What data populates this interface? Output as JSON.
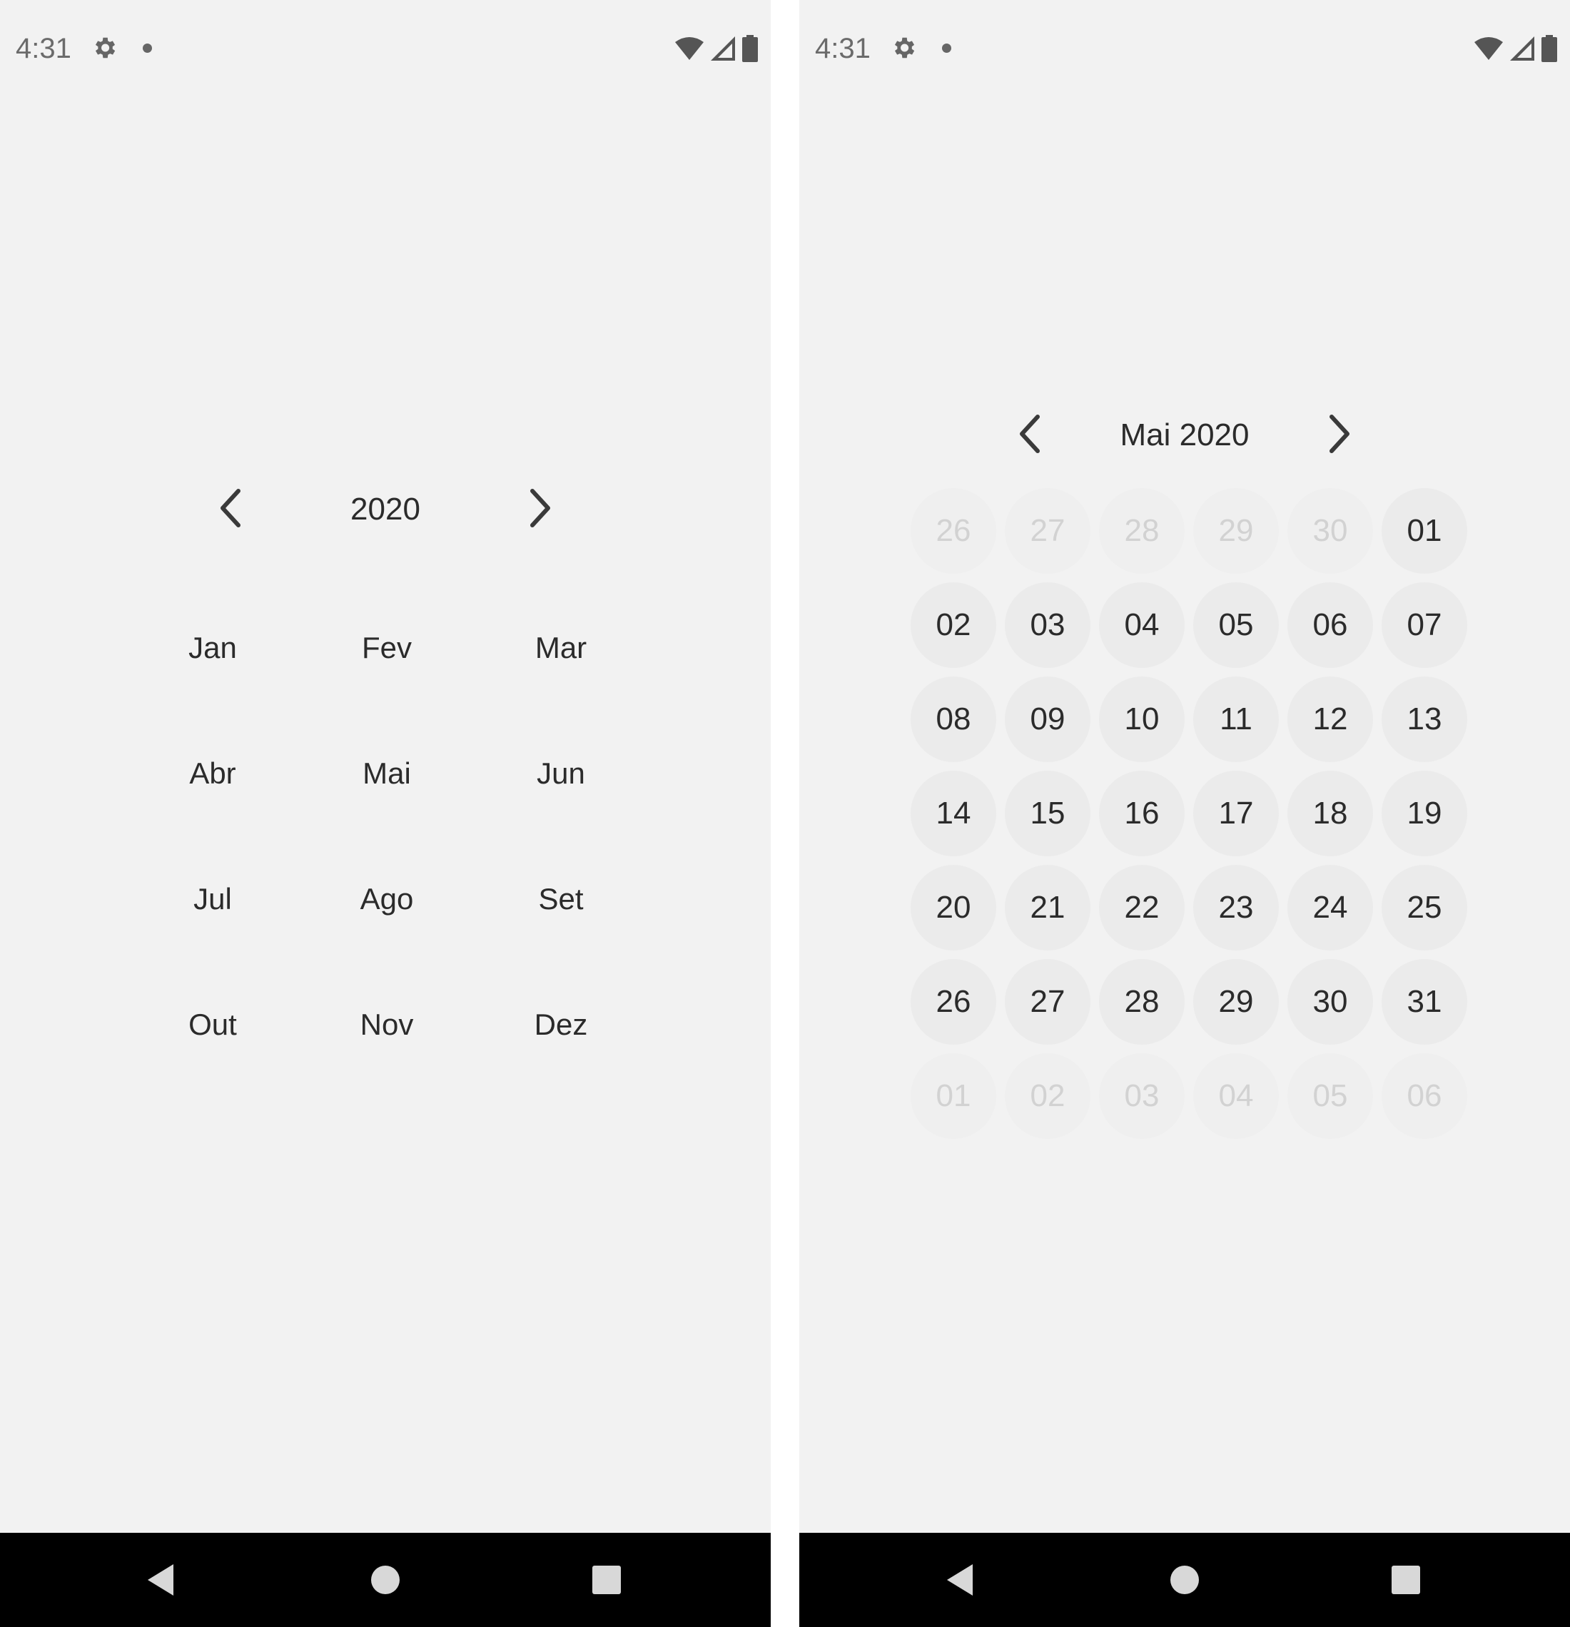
{
  "colors": {
    "background": "#f2f2f2",
    "text": "#2b2b2b",
    "muted_text": "#d2d2d2",
    "day_circle": "#ebebeb",
    "nav_bar": "#000000"
  },
  "status_bar": {
    "time": "4:31",
    "icons": [
      "gear-icon",
      "notification-dot-icon",
      "wifi-icon",
      "signal-icon",
      "battery-icon"
    ]
  },
  "month_picker": {
    "year_label": "2020",
    "months": [
      "Jan",
      "Fev",
      "Mar",
      "Abr",
      "Mai",
      "Jun",
      "Jul",
      "Ago",
      "Set",
      "Out",
      "Nov",
      "Dez"
    ]
  },
  "day_picker": {
    "month_label": "Mai 2020",
    "days": [
      {
        "label": "26",
        "muted": true
      },
      {
        "label": "27",
        "muted": true
      },
      {
        "label": "28",
        "muted": true
      },
      {
        "label": "29",
        "muted": true
      },
      {
        "label": "30",
        "muted": true
      },
      {
        "label": "01",
        "muted": false
      },
      {
        "label": "02",
        "muted": false
      },
      {
        "label": "03",
        "muted": false
      },
      {
        "label": "04",
        "muted": false
      },
      {
        "label": "05",
        "muted": false
      },
      {
        "label": "06",
        "muted": false
      },
      {
        "label": "07",
        "muted": false
      },
      {
        "label": "08",
        "muted": false
      },
      {
        "label": "09",
        "muted": false
      },
      {
        "label": "10",
        "muted": false
      },
      {
        "label": "11",
        "muted": false
      },
      {
        "label": "12",
        "muted": false
      },
      {
        "label": "13",
        "muted": false
      },
      {
        "label": "14",
        "muted": false
      },
      {
        "label": "15",
        "muted": false
      },
      {
        "label": "16",
        "muted": false
      },
      {
        "label": "17",
        "muted": false
      },
      {
        "label": "18",
        "muted": false
      },
      {
        "label": "19",
        "muted": false
      },
      {
        "label": "20",
        "muted": false
      },
      {
        "label": "21",
        "muted": false
      },
      {
        "label": "22",
        "muted": false
      },
      {
        "label": "23",
        "muted": false
      },
      {
        "label": "24",
        "muted": false
      },
      {
        "label": "25",
        "muted": false
      },
      {
        "label": "26",
        "muted": false
      },
      {
        "label": "27",
        "muted": false
      },
      {
        "label": "28",
        "muted": false
      },
      {
        "label": "29",
        "muted": false
      },
      {
        "label": "30",
        "muted": false
      },
      {
        "label": "31",
        "muted": false
      },
      {
        "label": "01",
        "muted": true
      },
      {
        "label": "02",
        "muted": true
      },
      {
        "label": "03",
        "muted": true
      },
      {
        "label": "04",
        "muted": true
      },
      {
        "label": "05",
        "muted": true
      },
      {
        "label": "06",
        "muted": true
      }
    ]
  },
  "nav_bar": {
    "icons": [
      "back-icon",
      "home-icon",
      "recents-icon"
    ]
  }
}
